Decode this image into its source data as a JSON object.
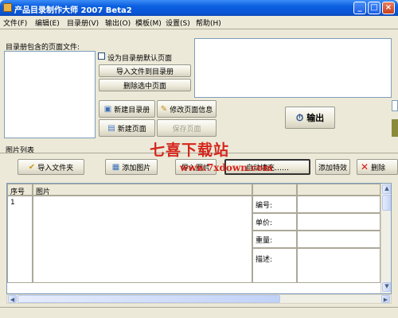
{
  "window": {
    "title": "产品目录制作大师 2007 Beta2",
    "minimize": "_",
    "maximize": "□",
    "close": "×"
  },
  "menu": [
    "文件(F)",
    "编辑(E)",
    "目录册(V)",
    "输出(O)",
    "模板(M)",
    "设置(S)",
    "帮助(H)"
  ],
  "pages_panel": {
    "label": "目录册包含的页面文件:",
    "default_checkbox_label": "设为目录册默认页面",
    "import_button": "导入文件到目录册",
    "delete_button": "删除选中页面",
    "new_catalog_button": "新建目录册",
    "edit_page_info_button": "修改页面信息",
    "new_page_button": "新建页面",
    "save_page_button": "保存页面",
    "output_button": "输出"
  },
  "images_panel": {
    "label": "图片列表",
    "import_folder_button": "导入文件夹",
    "add_image_button": "添加图片",
    "auto_fill_button": "自动填充……",
    "add_effect_button": "添加特效",
    "delete_button": "删除",
    "partial_button": "导入图片"
  },
  "table": {
    "columns": [
      "序号",
      "图片"
    ],
    "rows": [
      {
        "index": "1",
        "fields": [
          "编号:",
          "单价:",
          "重量:",
          "描述:"
        ]
      }
    ]
  },
  "watermark": {
    "line1": "七喜下载站",
    "line2": "www.7xdown.com"
  }
}
